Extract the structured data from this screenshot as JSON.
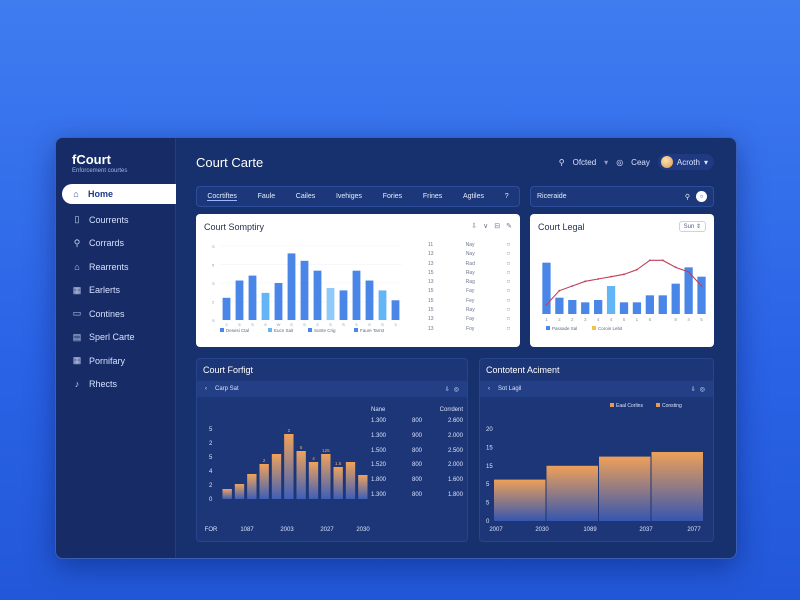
{
  "colors": {
    "accent": "#4a86e8",
    "light_bar": "#64b5f6",
    "orange": "#e69a55",
    "line": "#c0405a",
    "page_bg": "#2a63e6",
    "window": "#17306e"
  },
  "sidebar": {
    "brand": "fCourt",
    "brand_sub": "Enforcement courtes",
    "items": [
      {
        "label": "Home",
        "icon": "home-icon",
        "glyph": "⌂",
        "active": true
      },
      {
        "label": "Courrents",
        "icon": "document-icon",
        "glyph": "▯"
      },
      {
        "label": "Corrards",
        "icon": "search-icon",
        "glyph": "⚲"
      },
      {
        "label": "Rearrents",
        "icon": "house-icon",
        "glyph": "⌂"
      },
      {
        "label": "Earlerts",
        "icon": "calendar-icon",
        "glyph": "▦"
      },
      {
        "label": "Contines",
        "icon": "folder-icon",
        "glyph": "▭"
      },
      {
        "label": "Sperl Carte",
        "icon": "file-icon",
        "glyph": "▤"
      },
      {
        "label": "Pornifary",
        "icon": "grid-icon",
        "glyph": "▦"
      },
      {
        "label": "Rhects",
        "icon": "link-icon",
        "glyph": "♪"
      }
    ]
  },
  "header": {
    "title": "Court Carte",
    "search_label": "Ofcted",
    "search_glyph": "⚲",
    "chevron_glyph": "▾",
    "chat_label": "Ceay",
    "chat_glyph": "◎",
    "user_label": "Acroth",
    "user_chevron": "▾"
  },
  "tabs": [
    "Cocrtiftes",
    "Faule",
    "Cailes",
    "Ivehiges",
    "Fories",
    "Frines",
    "Agtiles",
    "?"
  ],
  "side_search": {
    "label": "Riceraide",
    "search_glyph": "⚲",
    "button_glyph": "○"
  },
  "card1": {
    "title": "Court Somptiry",
    "icons": [
      "⇩",
      "∨",
      "⊟",
      "✎"
    ],
    "table_rows": [
      [
        "11",
        "Nay",
        "□"
      ],
      [
        "13",
        "Nay",
        "□"
      ],
      [
        "13",
        "Rad",
        "□"
      ],
      [
        "15",
        "Ray",
        "□"
      ],
      [
        "13",
        "Rag",
        "□"
      ],
      [
        "15",
        "Fay",
        "□"
      ],
      [
        "15",
        "Fey",
        "□"
      ],
      [
        "15",
        "Ray",
        "□"
      ],
      [
        "13",
        "Fay",
        "□"
      ],
      [
        "13",
        "Foy",
        "□"
      ]
    ]
  },
  "card2": {
    "title": "Court Legal",
    "pill": "Sun ⇕"
  },
  "card3": {
    "title": "Court Forfigt",
    "bar_label": "Carp Sat",
    "bar_glyph_left": "‹",
    "bar_icons": [
      "⇩",
      "◎"
    ],
    "table": {
      "headers": [
        "Nane",
        "Corrdent"
      ],
      "rows": [
        [
          "1.300",
          "800",
          "2.600"
        ],
        [
          "1.300",
          "900",
          "2.000"
        ],
        [
          "1.500",
          "800",
          "2.500"
        ],
        [
          "1.520",
          "800",
          "2.000"
        ],
        [
          "1.800",
          "800",
          "1.600"
        ],
        [
          "1.300",
          "800",
          "1.800"
        ]
      ]
    }
  },
  "card4": {
    "title": "Contotent Aciment",
    "bar_label": "Sot Lagil",
    "bar_glyph_left": "‹",
    "bar_icons": [
      "⇩",
      "◎"
    ]
  },
  "chart_data": [
    {
      "type": "bar",
      "title": "Court Somptiry",
      "categories": [
        "1",
        "2",
        "3",
        "4",
        "5",
        "6",
        "7",
        "8",
        "9",
        "10",
        "11",
        "12",
        "13",
        "14"
      ],
      "series": [
        {
          "values": [
            4.5,
            8,
            9,
            5.5,
            7.5,
            13.5,
            12,
            10,
            6.5,
            6,
            10,
            8,
            6,
            4
          ]
        }
      ],
      "bar_colors": [
        "#4a86e8",
        "#4a86e8",
        "#4a86e8",
        "#64b5f6",
        "#4a86e8",
        "#4a86e8",
        "#4a86e8",
        "#4a86e8",
        "#90caf9",
        "#4a86e8",
        "#4a86e8",
        "#4a86e8",
        "#64b5f6",
        "#4a86e8"
      ],
      "x_tick_labels": [
        "2",
        "5",
        "S",
        "5",
        "W",
        "S",
        "S",
        "S",
        "S",
        "S",
        "5",
        "S",
        "S",
        "3"
      ],
      "y_ticks": [
        "S",
        "5",
        "S",
        "2",
        "S"
      ],
      "legend": [
        "Desesi Ctal",
        "Eucn Sait",
        "Sutrte Crig",
        "Faure Tarrst"
      ],
      "legend_colors": [
        "#4a86e8",
        "#64b5f6",
        "#4a86e8",
        "#4a86e8"
      ],
      "ylim": [
        0,
        15
      ]
    },
    {
      "type": "bar",
      "title": "Court Legal",
      "categories": [
        "1",
        "2",
        "3",
        "4",
        "5",
        "6",
        "7",
        "8",
        "9",
        "10",
        "11",
        "12",
        "13"
      ],
      "series": [
        {
          "name": "Passade Sal",
          "values": [
            11,
            3.5,
            3,
            2.5,
            3,
            6,
            2.5,
            2.5,
            4,
            4,
            6.5,
            10,
            8
          ]
        },
        {
          "name": "Coroin Lebit",
          "values": [
            2,
            5,
            6,
            7,
            7.5,
            8,
            8.5,
            9.5,
            11.5,
            11.5,
            10,
            9,
            6
          ]
        }
      ],
      "x_tick_labels": [
        "1",
        "2",
        "2",
        "3",
        "4",
        "4",
        "5",
        "1",
        "6",
        "",
        "8",
        "4",
        "5"
      ],
      "legend": [
        "Passade Sal",
        "Coroin Lebit"
      ],
      "legend_colors": [
        "#4a86e8",
        "#f2c14e"
      ],
      "ylim": [
        0,
        15
      ]
    },
    {
      "type": "bar",
      "title": "Court Forfigt",
      "categories": [
        "1",
        "2",
        "3",
        "4",
        "5",
        "6",
        "7",
        "8",
        "9",
        "10",
        "11",
        "12"
      ],
      "series": [
        {
          "values": [
            1,
            1.5,
            2.5,
            3.5,
            4.5,
            6.5,
            4.8,
            3.7,
            4.5,
            3.2,
            3.7,
            2.4
          ]
        }
      ],
      "x_tick_labels": [
        "FOR",
        "1087",
        "2003",
        "2027",
        "2030"
      ],
      "y_ticks": [
        "5",
        "2",
        "5",
        "4",
        "2",
        "0"
      ],
      "annotations": [
        "2",
        "2",
        "5",
        "4",
        "125",
        "1.5"
      ],
      "ylim": [
        0,
        7
      ]
    },
    {
      "type": "bar",
      "title": "Contotent Aciment",
      "categories": [
        "2007",
        "2030",
        "1089",
        "2037",
        "2077"
      ],
      "series": [
        {
          "name": "Eaal Corlins",
          "values": [
            9,
            12,
            14,
            15
          ]
        }
      ],
      "x_tick_labels": [
        "2007",
        "2030",
        "1089",
        "2037",
        "2077"
      ],
      "y_ticks": [
        "20",
        "15",
        "15",
        "5",
        "5",
        "0"
      ],
      "legend": [
        "Eaal Corlins",
        "Consting"
      ],
      "legend_colors": [
        "#e69a55",
        "#e69a55"
      ],
      "ylim": [
        0,
        20
      ]
    }
  ]
}
